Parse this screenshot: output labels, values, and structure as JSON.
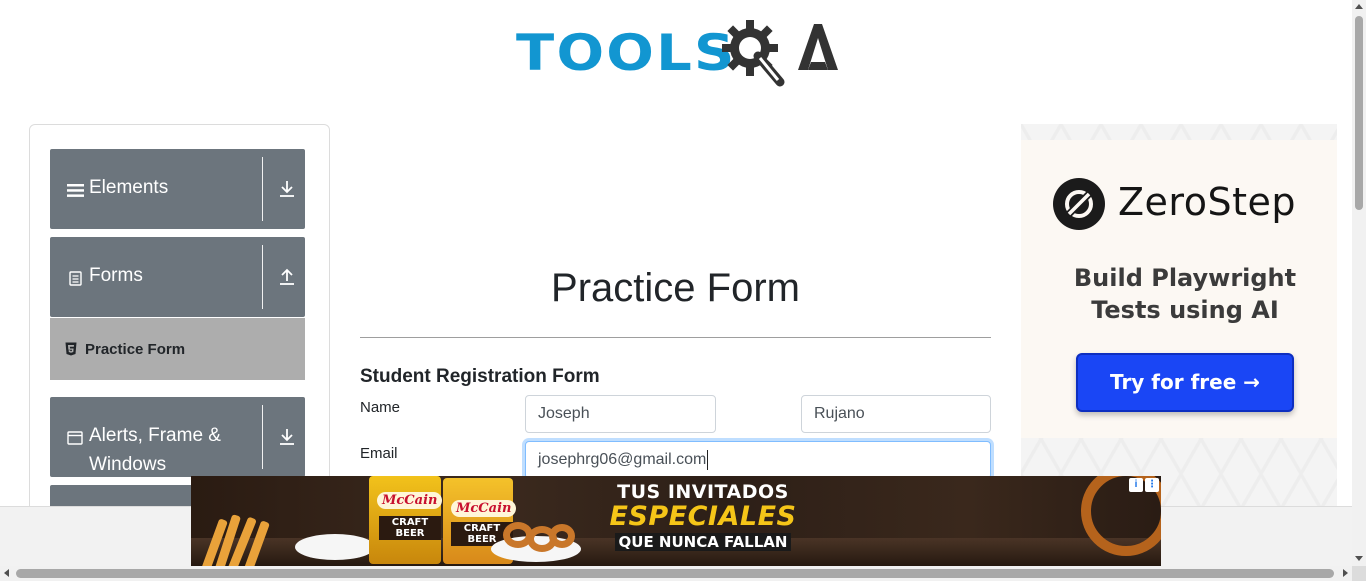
{
  "header": {
    "logo_text": "TOOLS",
    "logo_suffix": "QA",
    "brand_color": "#1296d1",
    "brand_dark": "#333333"
  },
  "sidebar": {
    "groups": [
      {
        "label": "Elements",
        "icon": "hamburger-icon",
        "toggle_icon": "arrow-down-icon"
      },
      {
        "label": "Forms",
        "icon": "document-icon",
        "toggle_icon": "arrow-up-icon",
        "items": [
          {
            "label": "Practice Form",
            "icon": "html5-icon",
            "active": true
          }
        ]
      },
      {
        "label": "Alerts, Frame &",
        "label_line2": "Windows",
        "icon": "window-icon",
        "toggle_icon": "arrow-down-icon"
      }
    ],
    "group_color": "#6c757d",
    "active_item_color": "#adadad"
  },
  "main": {
    "title": "Practice Form",
    "form_heading": "Student Registration Form",
    "fields": {
      "name_label": "Name",
      "first_name_value": "Joseph",
      "last_name_value": "Rujano",
      "email_label": "Email",
      "email_value": "josephrg06@gmail.com"
    }
  },
  "ad_right": {
    "brand": "ZeroStep",
    "tagline_line1": "Build Playwright",
    "tagline_line2": "Tests using AI",
    "cta": "Try for free →",
    "cta_color": "#1a46f5"
  },
  "ad_bottom": {
    "brand": "McCain",
    "product1": "CRAFT BEER",
    "product2": "CRAFT BEER",
    "headline_line1": "TUS INVITADOS",
    "headline_line2": "ESPECIALES",
    "headline_line3": "QUE NUNCA FALLAN",
    "info_icon": "info-icon",
    "more_icon": "more-vertical-icon"
  }
}
